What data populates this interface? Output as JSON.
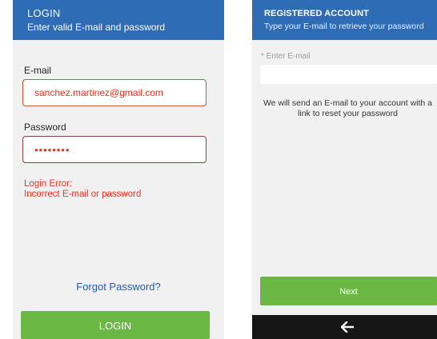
{
  "login": {
    "header": {
      "title": "LOGIN",
      "subtitle": "Enter valid E-mail and password"
    },
    "email": {
      "label": "E-mail",
      "value": "sanchez.martinez@gmail.com"
    },
    "password": {
      "label": "Password",
      "value": "••••••••"
    },
    "error": {
      "line1": "Login Error:",
      "line2": "Incorrect E-mail or password"
    },
    "forgot_label": "Forgot Password?",
    "button_label": "LOGIN"
  },
  "reset": {
    "header": {
      "title": "REGISTERED ACCOUNT",
      "subtitle": "Type your E-mail to retrieve your password"
    },
    "field_label": "* Enter E-mail",
    "field_value": "",
    "info": "We will send an E-mail to your account with a link to reset your password",
    "next_label": "Next",
    "back_icon": "arrow-left-icon"
  },
  "colors": {
    "header": "#2e6db5",
    "button": "#6ab744",
    "error": "#ee3322",
    "link": "#1f5fb0",
    "nav_bar": "#161616"
  }
}
